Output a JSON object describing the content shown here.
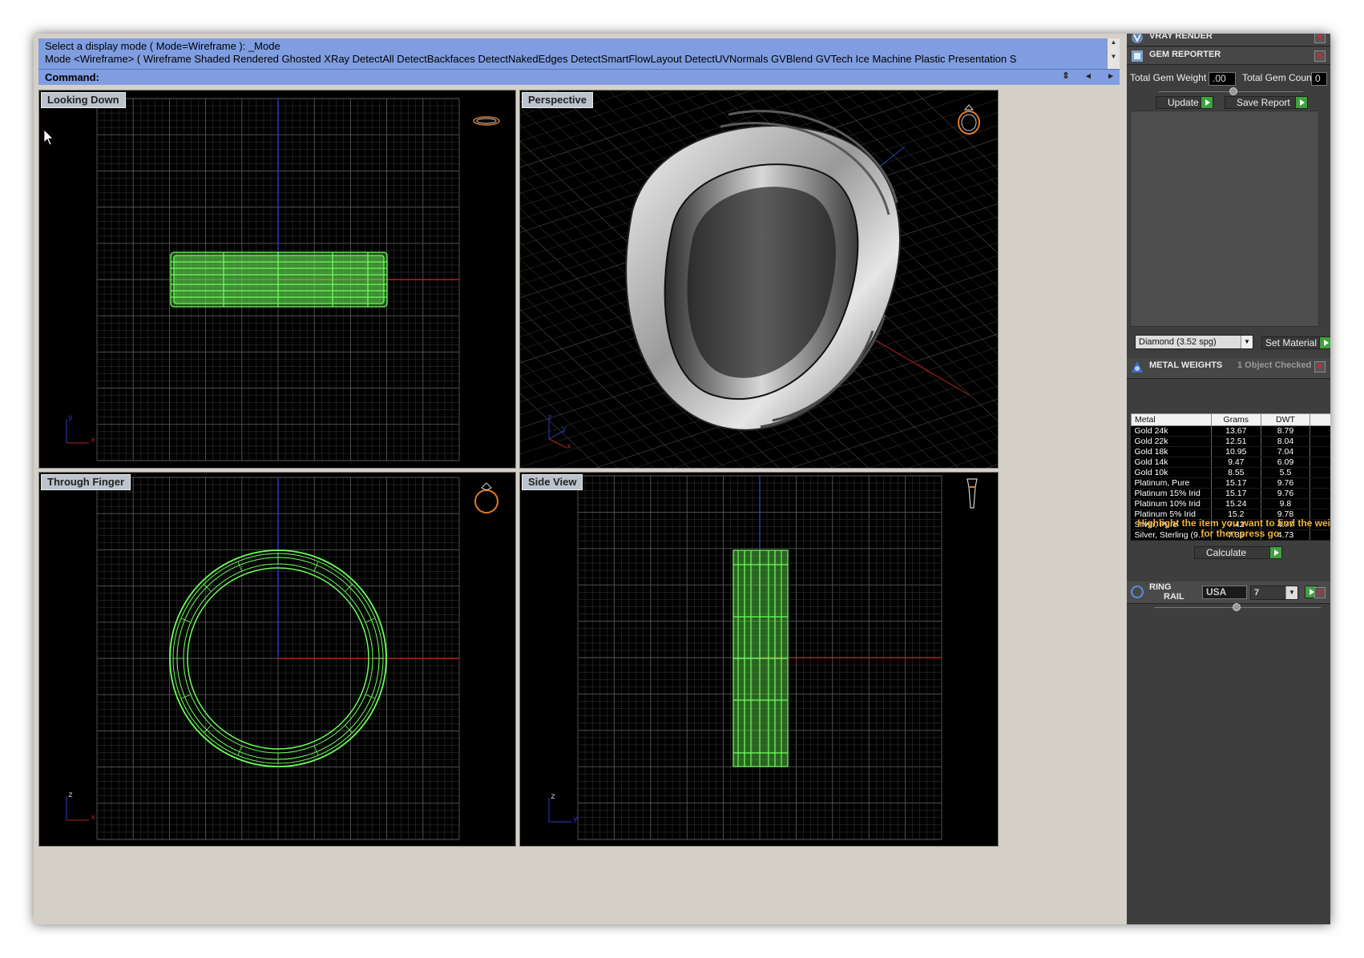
{
  "command": {
    "history_line1": "Select a display mode ( Mode=Wireframe ): _Mode",
    "history_line2": "Mode <Wireframe> ( Wireframe  Shaded  Rendered  Ghosted  XRay  DetectAll  DetectBackfaces  DetectNakedEdges  DetectSmartFlowLayout  DetectUVNormals  GVBlend  GVTech  Ice  Machine  Plastic  Presentation  S",
    "prompt_label": "Command:",
    "input_value": ""
  },
  "viewports": {
    "top_left": {
      "title": "Looking Down",
      "axis_a": "y",
      "axis_b": "x"
    },
    "top_right": {
      "title": "Perspective",
      "axis_a": "z",
      "axis_b": "y",
      "axis_c": "x"
    },
    "bottom_left": {
      "title": "Through Finger",
      "axis_a": "z",
      "axis_b": "x"
    },
    "bottom_right": {
      "title": "Side View",
      "axis_a": "z",
      "axis_b": "y"
    }
  },
  "panel": {
    "vray": {
      "title": "VRAY RENDER"
    },
    "gem": {
      "title": "GEM REPORTER",
      "total_weight_label": "Total Gem Weight",
      "total_weight_value": ".00",
      "total_count_label": "Total Gem Count",
      "total_count_value": "0",
      "update_label": "Update",
      "save_label": "Save Report",
      "material_select": "Diamond    (3.52 spg)",
      "set_material_label": "Set Material"
    },
    "metal": {
      "title": "METAL WEIGHTS",
      "status": "1 Object Checked",
      "columns": [
        "Metal",
        "Grams",
        "DWT"
      ],
      "rows": [
        [
          "Gold 24k",
          "13.67",
          "8.79"
        ],
        [
          "Gold 22k",
          "12.51",
          "8.04"
        ],
        [
          "Gold 18k",
          "10.95",
          "7.04"
        ],
        [
          "Gold 14k",
          "9.47",
          "6.09"
        ],
        [
          "Gold 10k",
          "8.55",
          "5.5"
        ],
        [
          "Platinum, Pure",
          "15.17",
          "9.76"
        ],
        [
          "Platinum 15% Irid",
          "15.17",
          "9.76"
        ],
        [
          "Platinum 10% Irid",
          "15.24",
          "9.8"
        ],
        [
          "Platinum 5% Irid",
          "15.2",
          "9.78"
        ],
        [
          "Silver, Pure",
          "7.42",
          "4.77"
        ],
        [
          "Silver, Sterling (9...",
          "7.35",
          "4.73"
        ]
      ],
      "hint": "Highlight the item you want to find the weight for then press go.",
      "calculate_label": "Calculate"
    },
    "ring": {
      "title_line1": "RING",
      "title_line2": "RAIL",
      "region_value": "USA",
      "size_value": "7"
    }
  },
  "colors": {
    "command_bg": "#7f9de0",
    "wire_green": "#6cff5a",
    "grid": "#3a3a3a",
    "grid_major": "#5a5a5a",
    "axis_red": "#b52222",
    "axis_blue": "#2a3fc0",
    "panel_bg": "#3e3e3e",
    "hint_orange": "#f0b23a"
  }
}
